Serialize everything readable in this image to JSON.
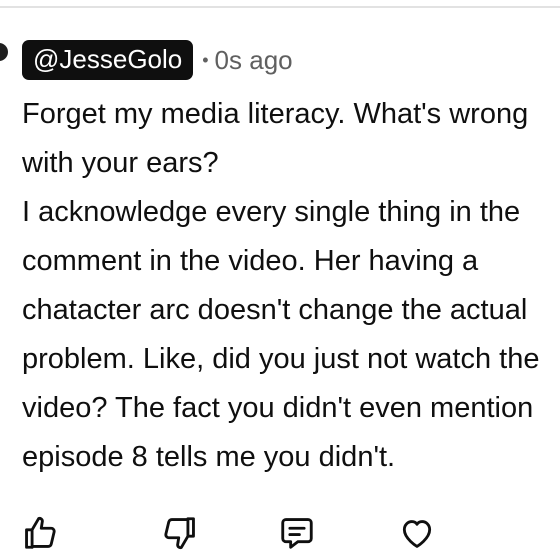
{
  "comment": {
    "handle": "@JesseGolo",
    "separator": "•",
    "timestamp": "0s ago",
    "lines": [
      "Forget my media literacy. What's wrong",
      "with your ears?",
      "I acknowledge every single thing in the",
      "comment in the video. Her having a",
      "chatacter arc doesn't change the actual",
      "problem. Like, did you just not watch the",
      "video? The fact you didn't even mention",
      "episode 8 tells me you didn't."
    ]
  },
  "actions": {
    "icons": [
      "thumbs-up-icon",
      "thumbs-down-icon",
      "reply-icon",
      "heart-icon"
    ]
  }
}
